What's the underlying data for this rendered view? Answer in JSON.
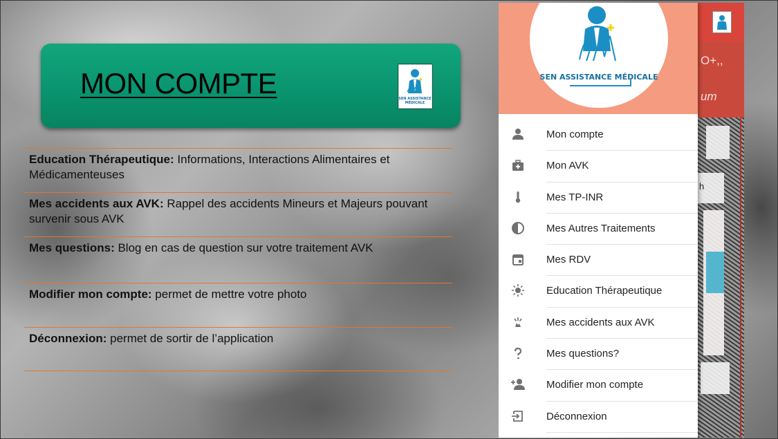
{
  "slide": {
    "title": "MON COMPTE",
    "logo_caption": "SEN ASSISTANCE MÉDICALE",
    "rows": [
      {
        "term": "Education Thérapeutique:",
        "desc": " Informations, Interactions Alimentaires et Médicamenteuses"
      },
      {
        "term": "Mes accidents aux AVK:",
        "desc": " Rappel des accidents Mineurs et Majeurs pouvant survenir sous AVK"
      },
      {
        "term": "Mes questions:",
        "desc": " Blog en cas de question sur votre traitement AVK"
      },
      {
        "term": "Modifier mon compte:",
        "desc": " permet de mettre votre photo"
      },
      {
        "term": "Déconnexion:",
        "desc": " permet de sortir de l’application"
      }
    ]
  },
  "app": {
    "logo_text": "SEN ASSISTANCE MÉDICALE",
    "behind_text_1": "O+,,",
    "behind_text_2": "um",
    "behind_text_3": "h",
    "colors": {
      "header": "#f59b80",
      "app_bar": "#d9453a",
      "banner": "#0a9470",
      "accent_line": "#e0782e"
    },
    "menu": [
      {
        "label": "Mon compte",
        "icon": "person-icon"
      },
      {
        "label": "Mon AVK",
        "icon": "medical-bag-icon"
      },
      {
        "label": "Mes TP-INR",
        "icon": "thermometer-icon"
      },
      {
        "label": "Mes Autres Traitements",
        "icon": "contrast-icon"
      },
      {
        "label": "Mes RDV",
        "icon": "calendar-icon"
      },
      {
        "label": "Education Thérapeutique",
        "icon": "sun-icon"
      },
      {
        "label": "Mes accidents aux AVK",
        "icon": "accident-icon"
      },
      {
        "label": "Mes questions?",
        "icon": "question-icon"
      },
      {
        "label": "Modifier mon compte",
        "icon": "add-person-icon"
      },
      {
        "label": "Déconnexion",
        "icon": "logout-icon"
      }
    ]
  }
}
